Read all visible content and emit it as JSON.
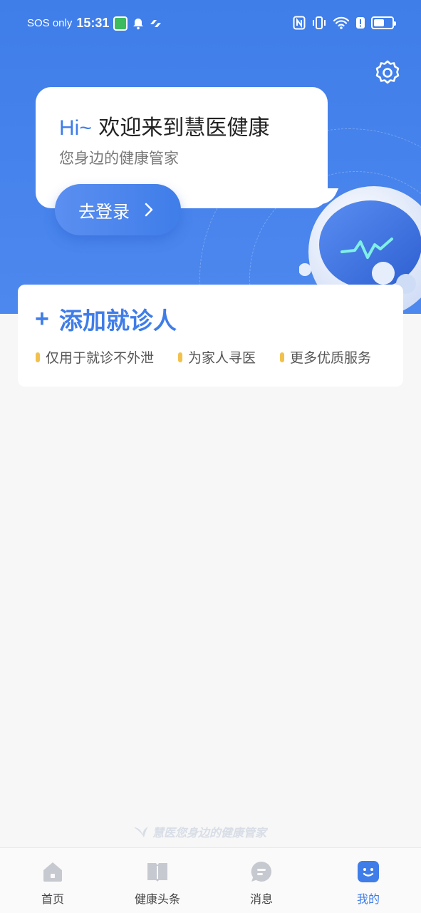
{
  "status_bar": {
    "carrier": "SOS only",
    "time": "15:31",
    "battery_level": 0.6
  },
  "header": {
    "greeting_hi": "Hi~",
    "greeting_text": "欢迎来到慧医健康",
    "subtitle": "您身边的健康管家",
    "login_label": "去登录"
  },
  "card": {
    "add_label": "添加就诊人",
    "features": [
      "仅用于就诊不外泄",
      "为家人寻医",
      "更多优质服务"
    ]
  },
  "watermark": "慧医您身边的健康管家",
  "tabbar": {
    "items": [
      {
        "label": "首页",
        "icon": "home-icon"
      },
      {
        "label": "健康头条",
        "icon": "book-icon"
      },
      {
        "label": "消息",
        "icon": "message-icon"
      },
      {
        "label": "我的",
        "icon": "profile-icon"
      }
    ],
    "active_index": 3
  },
  "colors": {
    "primary": "#3f7de9",
    "accent_dot": "#f2c14c",
    "background": "#f7f7f7"
  }
}
